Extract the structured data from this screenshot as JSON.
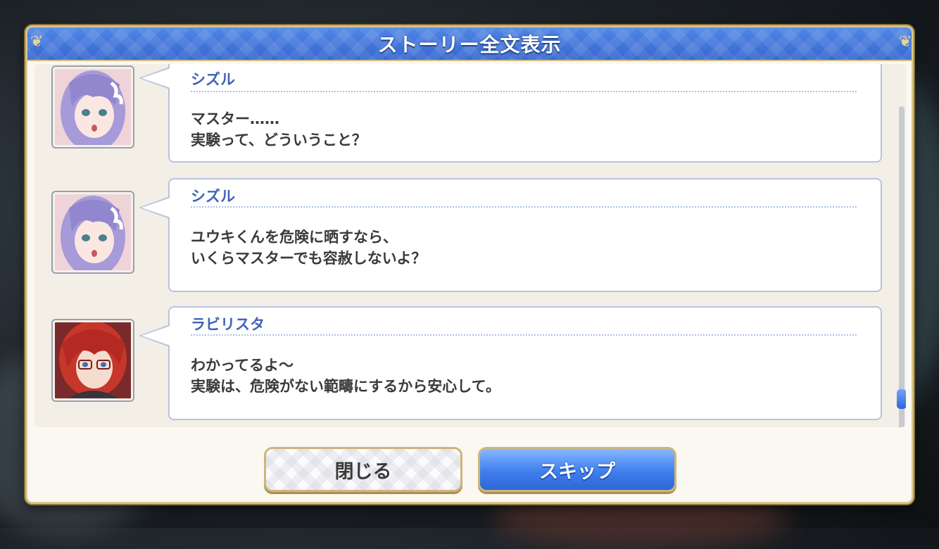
{
  "dialog": {
    "title": "ストーリー全文表示"
  },
  "entries": [
    {
      "speaker": "シズル",
      "line1": "マスター……",
      "line2": "実験って、どういうこと？",
      "avatar": "shizuru-portrait"
    },
    {
      "speaker": "シズル",
      "line1": "ユウキくんを危険に晒すなら、",
      "line2": "いくらマスターでも容赦しないよ？",
      "avatar": "shizuru-portrait"
    },
    {
      "speaker": "ラビリスタ",
      "line1": "わかってるよ～",
      "line2": "実験は、危険がない範疇にするから安心して。",
      "avatar": "labyrista-portrait"
    }
  ],
  "scroll": {
    "position_fraction": 0.86
  },
  "buttons": {
    "close": "閉じる",
    "skip": "スキップ"
  },
  "colors": {
    "header_blue": "#3e73d8",
    "speaker_blue": "#3f63b8",
    "gold_border": "#d8c58a"
  }
}
